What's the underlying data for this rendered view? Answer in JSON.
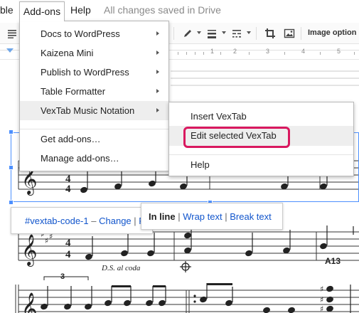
{
  "menubar": {
    "table_partial": "ble",
    "addons": "Add-ons",
    "help": "Help",
    "status": "All changes saved in Drive"
  },
  "toolbar": {
    "image_options": "Image option"
  },
  "ruler": {
    "numbers": [
      "1",
      "2",
      "3",
      "4",
      "5"
    ]
  },
  "addons_menu": {
    "items": [
      {
        "label": "Docs to WordPress",
        "has_submenu": true
      },
      {
        "label": "Kaizena Mini",
        "has_submenu": true
      },
      {
        "label": "Publish to WordPress",
        "has_submenu": true
      },
      {
        "label": "Table Formatter",
        "has_submenu": true
      },
      {
        "label": "VexTab Music Notation",
        "has_submenu": true,
        "highlighted": true
      },
      {
        "label": "Get add-ons…"
      },
      {
        "label": "Manage add-ons…"
      }
    ]
  },
  "vextab_submenu": {
    "items": [
      {
        "label": "Insert VexTab"
      },
      {
        "label": "Edit selected VexTab",
        "highlighted": true,
        "circled": true
      },
      {
        "label": "Help"
      }
    ],
    "circle_color": "#d9185f"
  },
  "code_bubble": {
    "code_name": "#vextab-code-1",
    "dash": "–",
    "change": "Change",
    "bar": "|",
    "truncated": "R"
  },
  "wrap_popup": {
    "in_line": "In line",
    "bar": "|",
    "wrap_text": "Wrap text",
    "break_text": "Break text"
  },
  "score": {
    "time_top": "4",
    "time_bottom": "4",
    "ds_al_coda": "D.S. al coda",
    "chord": "A13",
    "triplet": "3"
  },
  "colors": {
    "link": "#1155cc",
    "selection": "#4d90fe",
    "menu_highlight": "#eeeeee"
  }
}
